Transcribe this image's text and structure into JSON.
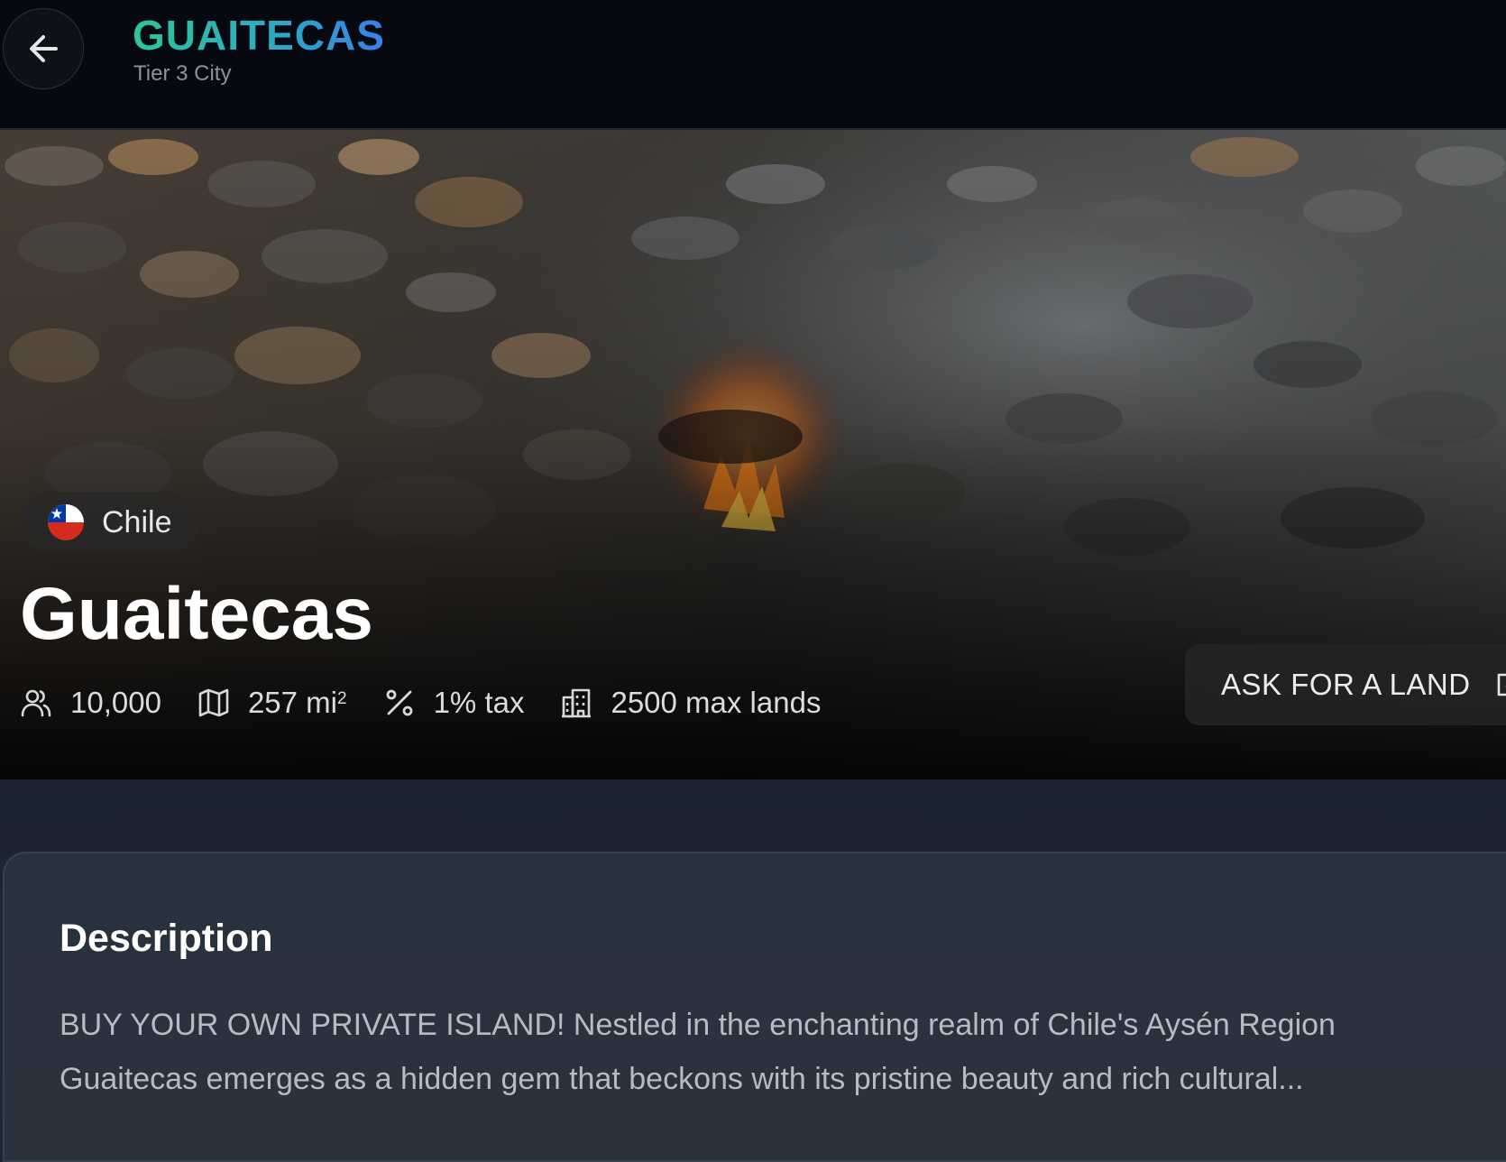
{
  "header": {
    "title": "GUAITECAS",
    "subtitle": "Tier 3 City",
    "back_icon": "arrow-left-icon"
  },
  "hero": {
    "country": "Chile",
    "country_flag": "chile-flag-icon",
    "city_name": "Guaitecas",
    "stats": {
      "population": "10,000",
      "area": "257 mi",
      "area_unit_exp": "2",
      "tax": "1% tax",
      "max_lands": "2500 max lands"
    },
    "ask_button": "ASK FOR A LAND"
  },
  "description": {
    "title": "Description",
    "line1": "BUY YOUR OWN PRIVATE ISLAND! Nestled in the enchanting realm of Chile's Aysén Region",
    "line2": "Guaitecas emerges as a hidden gem that beckons with its pristine beauty and rich cultural..."
  },
  "colors": {
    "title_gradient_start": "#2dc59a",
    "title_gradient_end": "#3b7fe8",
    "header_bg": "#060a10",
    "content_bg": "#1f2a38"
  }
}
